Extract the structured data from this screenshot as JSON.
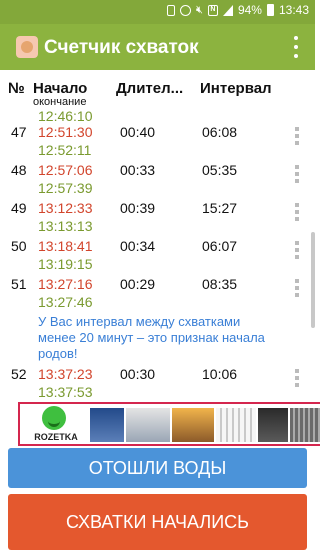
{
  "status_bar": {
    "battery": "94%",
    "time": "13:43",
    "icons": [
      "tablet-icon",
      "alarm-icon",
      "mute-icon",
      "nfc-icon",
      "signal-icon",
      "battery-icon"
    ]
  },
  "app": {
    "title": "Счетчик схваток",
    "colors": {
      "appbar": "#8cb33f",
      "start_time": "#d2452c",
      "end_time": "#7a9a2f",
      "tip": "#3a7fd6",
      "water_button": "#4b93d9",
      "contractions_button": "#e4582e"
    }
  },
  "headers": {
    "num": "№",
    "start": "Начало",
    "end": "окончание",
    "duration": "Длител...",
    "interval": "Интервал"
  },
  "partial_top": {
    "end": "12:46:10"
  },
  "rows": [
    {
      "num": "47",
      "start": "12:51:30",
      "end": "12:52:11",
      "duration": "00:40",
      "interval": "06:08"
    },
    {
      "num": "48",
      "start": "12:57:06",
      "end": "12:57:39",
      "duration": "00:33",
      "interval": "05:35"
    },
    {
      "num": "49",
      "start": "13:12:33",
      "end": "13:13:13",
      "duration": "00:39",
      "interval": "15:27"
    },
    {
      "num": "50",
      "start": "13:18:41",
      "end": "13:19:15",
      "duration": "00:34",
      "interval": "06:07"
    },
    {
      "num": "51",
      "start": "13:27:16",
      "end": "13:27:46",
      "duration": "00:29",
      "interval": "08:35"
    },
    {
      "num": "52",
      "start": "13:37:23",
      "end": "13:37:53",
      "duration": "00:30",
      "interval": "10:06"
    }
  ],
  "tip_text": "У Вас интервал между схватками менее 20 минут – это признак начала родов!",
  "ad": {
    "brand": "ROZETKA"
  },
  "buttons": {
    "water": "ОТОШЛИ ВОДЫ",
    "contractions": "СХВАТКИ НАЧАЛИСЬ"
  }
}
